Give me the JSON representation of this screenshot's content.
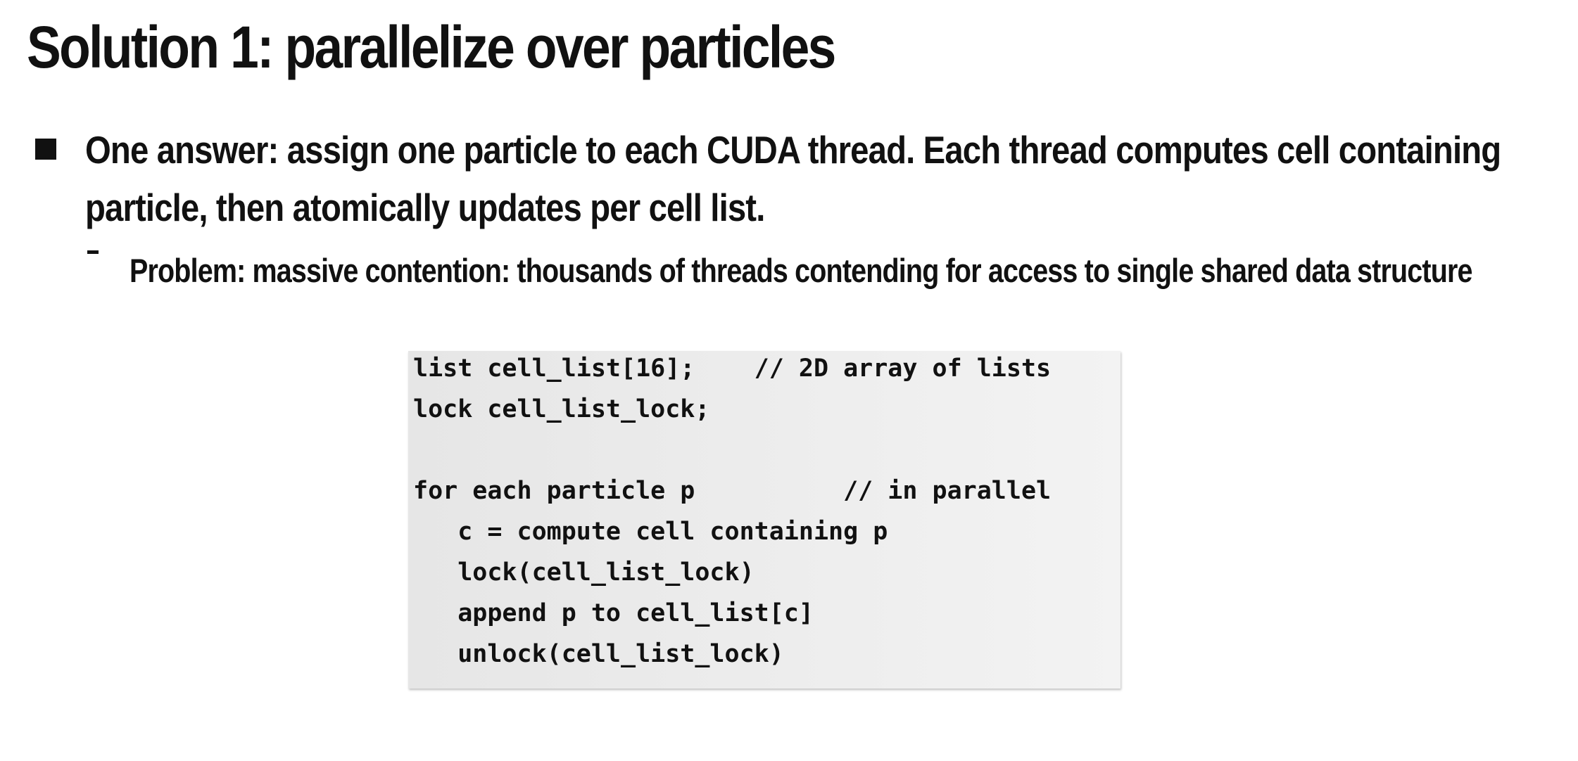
{
  "slide": {
    "title": "Solution 1: parallelize over particles",
    "bullet": "One answer: assign one particle to each CUDA thread. Each thread computes cell containing particle, then atomically updates per cell list.",
    "sub_bullet": "Problem: massive contention: thousands of threads contending for access to single shared data structure"
  },
  "code": {
    "lines": [
      "list cell_list[16];    // 2D array of lists",
      "lock cell_list_lock;",
      "",
      "for each particle p          // in parallel",
      "   c = compute cell containing p",
      "   lock(cell_list_lock)",
      "   append p to cell_list[c]",
      "   unlock(cell_list_lock)"
    ]
  },
  "colors": {
    "text": "#111111",
    "code_background": "#ececec"
  }
}
